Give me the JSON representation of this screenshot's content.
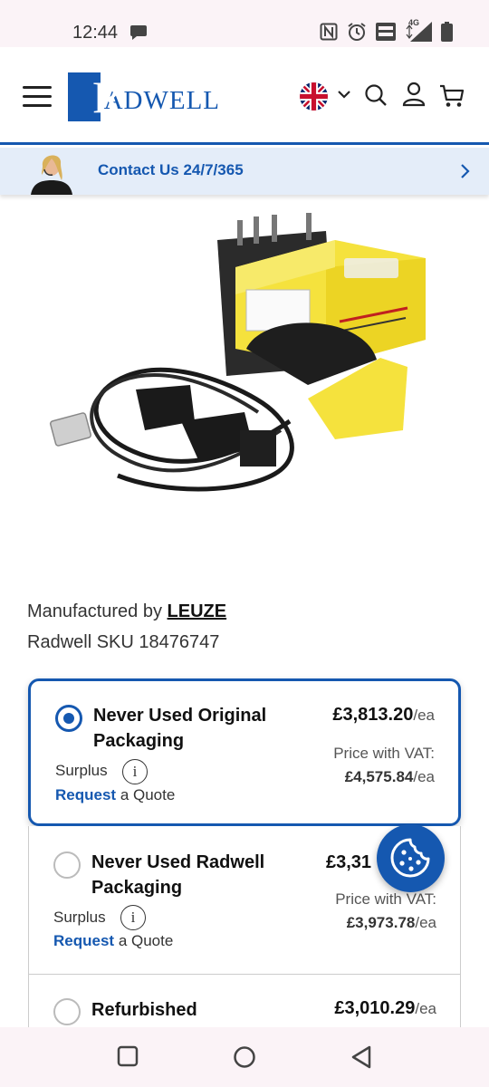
{
  "status_bar": {
    "time": "12:44",
    "network": "4G"
  },
  "header": {
    "logo_initial": "R",
    "logo_rest": "ADWELL",
    "logo_brand": "Radwell",
    "brand_color": "#1558b0"
  },
  "contact": {
    "label": "Contact Us",
    "hours": "24/7/365"
  },
  "product": {
    "manufactured_by_label": "Manufactured by",
    "manufacturer": "LEUZE",
    "sku_label": "Radwell SKU",
    "sku": "18476747"
  },
  "options": [
    {
      "title": "Never Used Original Packaging",
      "condition": "Surplus",
      "request_label": "Request",
      "quote_label": "a Quote",
      "price": "£3,813.20",
      "unit": "/ea",
      "vat_label": "Price with VAT:",
      "vat_price": "£4,575.84",
      "selected": true
    },
    {
      "title": "Never Used Radwell Packaging",
      "condition": "Surplus",
      "request_label": "Request",
      "quote_label": "a Quote",
      "price": "£3,31",
      "unit": "",
      "vat_label": "Price with VAT:",
      "vat_price": "£3,973.78",
      "selected": false
    },
    {
      "title": "Refurbished",
      "price": "£3,010.29",
      "unit": "/ea",
      "selected": false
    }
  ],
  "icons": {
    "status": [
      "chat-icon",
      "nfc-icon",
      "alarm-icon",
      "volte-icon",
      "signal-icon",
      "battery-icon"
    ],
    "header": [
      "menu-icon",
      "uk-flag-icon",
      "chevron-down-icon",
      "search-icon",
      "account-icon",
      "cart-icon"
    ],
    "nav": [
      "recents-icon",
      "home-icon",
      "back-icon"
    ]
  }
}
